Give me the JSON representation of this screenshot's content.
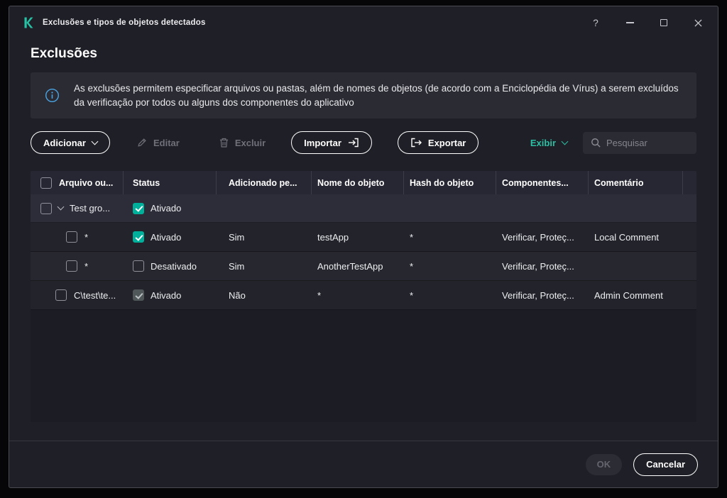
{
  "colors": {
    "accent_green": "#2dbfa4",
    "checkbox_checked": "#00b09a",
    "info_blue": "#4aa3e0",
    "background": "#1f1f27"
  },
  "window": {
    "title": "Exclusões e tipos de objetos detectados",
    "help_label": "?"
  },
  "page": {
    "title": "Exclusões",
    "info_text": "As exclusões permitem especificar arquivos ou pastas, além de nomes de objetos (de acordo com a Enciclopédia de Vírus) a serem excluídos da verificação por todos ou alguns dos componentes do aplicativo"
  },
  "toolbar": {
    "add_label": "Adicionar",
    "edit_label": "Editar",
    "delete_label": "Excluir",
    "import_label": "Importar",
    "export_label": "Exportar",
    "view_label": "Exibir",
    "search_placeholder": "Pesquisar"
  },
  "table": {
    "select_all_checked": false,
    "columns": {
      "file": "Arquivo ou...",
      "status": "Status",
      "added": "Adicionado pe...",
      "object_name": "Nome do objeto",
      "object_hash": "Hash do objeto",
      "components": "Componentes...",
      "comment": "Comentário"
    },
    "group": {
      "selected": false,
      "name": "Test gro...",
      "status_checked": true,
      "status_label": "Ativado"
    },
    "rows": [
      {
        "selected": false,
        "file": "*",
        "status_checked": true,
        "status_disabled": false,
        "status_label": "Ativado",
        "added": "Sim",
        "object_name": "testApp",
        "object_hash": "*",
        "components": "Verificar, Proteç...",
        "comment": "Local Comment"
      },
      {
        "selected": false,
        "file": "*",
        "status_checked": false,
        "status_disabled": false,
        "status_label": "Desativado",
        "added": "Sim",
        "object_name": "AnotherTestApp",
        "object_hash": "*",
        "components": "Verificar, Proteç...",
        "comment": ""
      },
      {
        "selected": false,
        "file": "C\\test\\te...",
        "status_checked": true,
        "status_disabled": true,
        "status_label": "Ativado",
        "added": "Não",
        "object_name": "*",
        "object_hash": "*",
        "components": "Verificar, Proteç...",
        "comment": "Admin Comment"
      }
    ]
  },
  "footer": {
    "ok_label": "OK",
    "cancel_label": "Cancelar"
  }
}
